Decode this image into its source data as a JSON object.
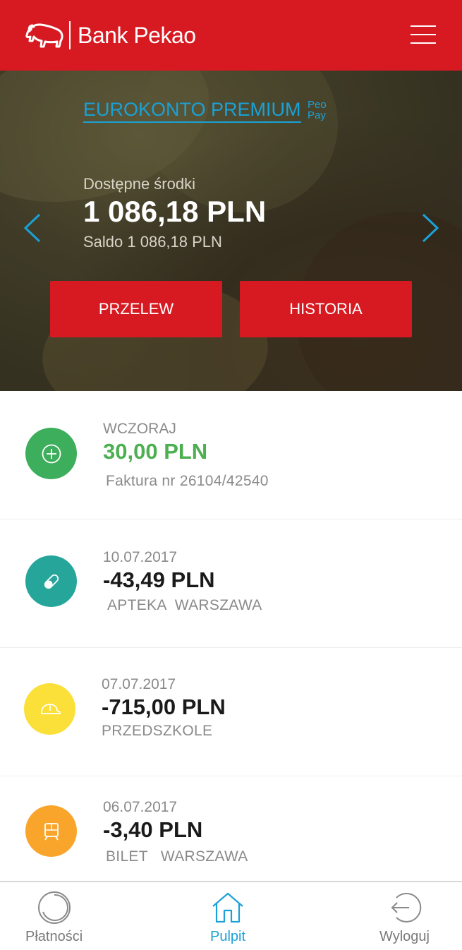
{
  "header": {
    "brand": "Bank Pekao",
    "menu_icon": "hamburger-menu-icon"
  },
  "account": {
    "name": "EUROKONTO PREMIUM",
    "badge_line1": "Peo",
    "badge_line2": "Pay",
    "available_label": "Dostępne środki",
    "available_amount": "1 086,18 PLN",
    "saldo": "Saldo 1 086,18 PLN",
    "prev_icon": "chevron-left-icon",
    "next_icon": "chevron-right-icon"
  },
  "actions": {
    "transfer": "PRZELEW",
    "history": "HISTORIA"
  },
  "transactions": [
    {
      "date": "WCZORAJ",
      "amount": "30,00 PLN",
      "description": "Faktura nr 26104/42540",
      "icon": "plus-circle-icon",
      "color": "#3dae5b"
    },
    {
      "date": "10.07.2017",
      "amount": "-43,49 PLN",
      "description": "APTEKA  WARSZAWA",
      "icon": "pill-icon",
      "color": "#26a69a"
    },
    {
      "date": "07.07.2017",
      "amount": "-715,00 PLN",
      "description": "PRZEDSZKOLE",
      "icon": "cap-icon",
      "color": "#fbe03a"
    },
    {
      "date": "06.07.2017",
      "amount": "-3,40 PLN",
      "description": "BILET   WARSZAWA",
      "icon": "train-icon",
      "color": "#f9a52b"
    }
  ],
  "bottom_nav": {
    "items": [
      {
        "label": "Płatności",
        "icon": "payments-icon"
      },
      {
        "label": "Pulpit",
        "icon": "home-icon",
        "active": true
      },
      {
        "label": "Wyloguj",
        "icon": "logout-icon"
      }
    ]
  },
  "colors": {
    "brand_red": "#d71a21",
    "accent_blue": "#1aa1d6",
    "positive_green": "#4caf50"
  }
}
